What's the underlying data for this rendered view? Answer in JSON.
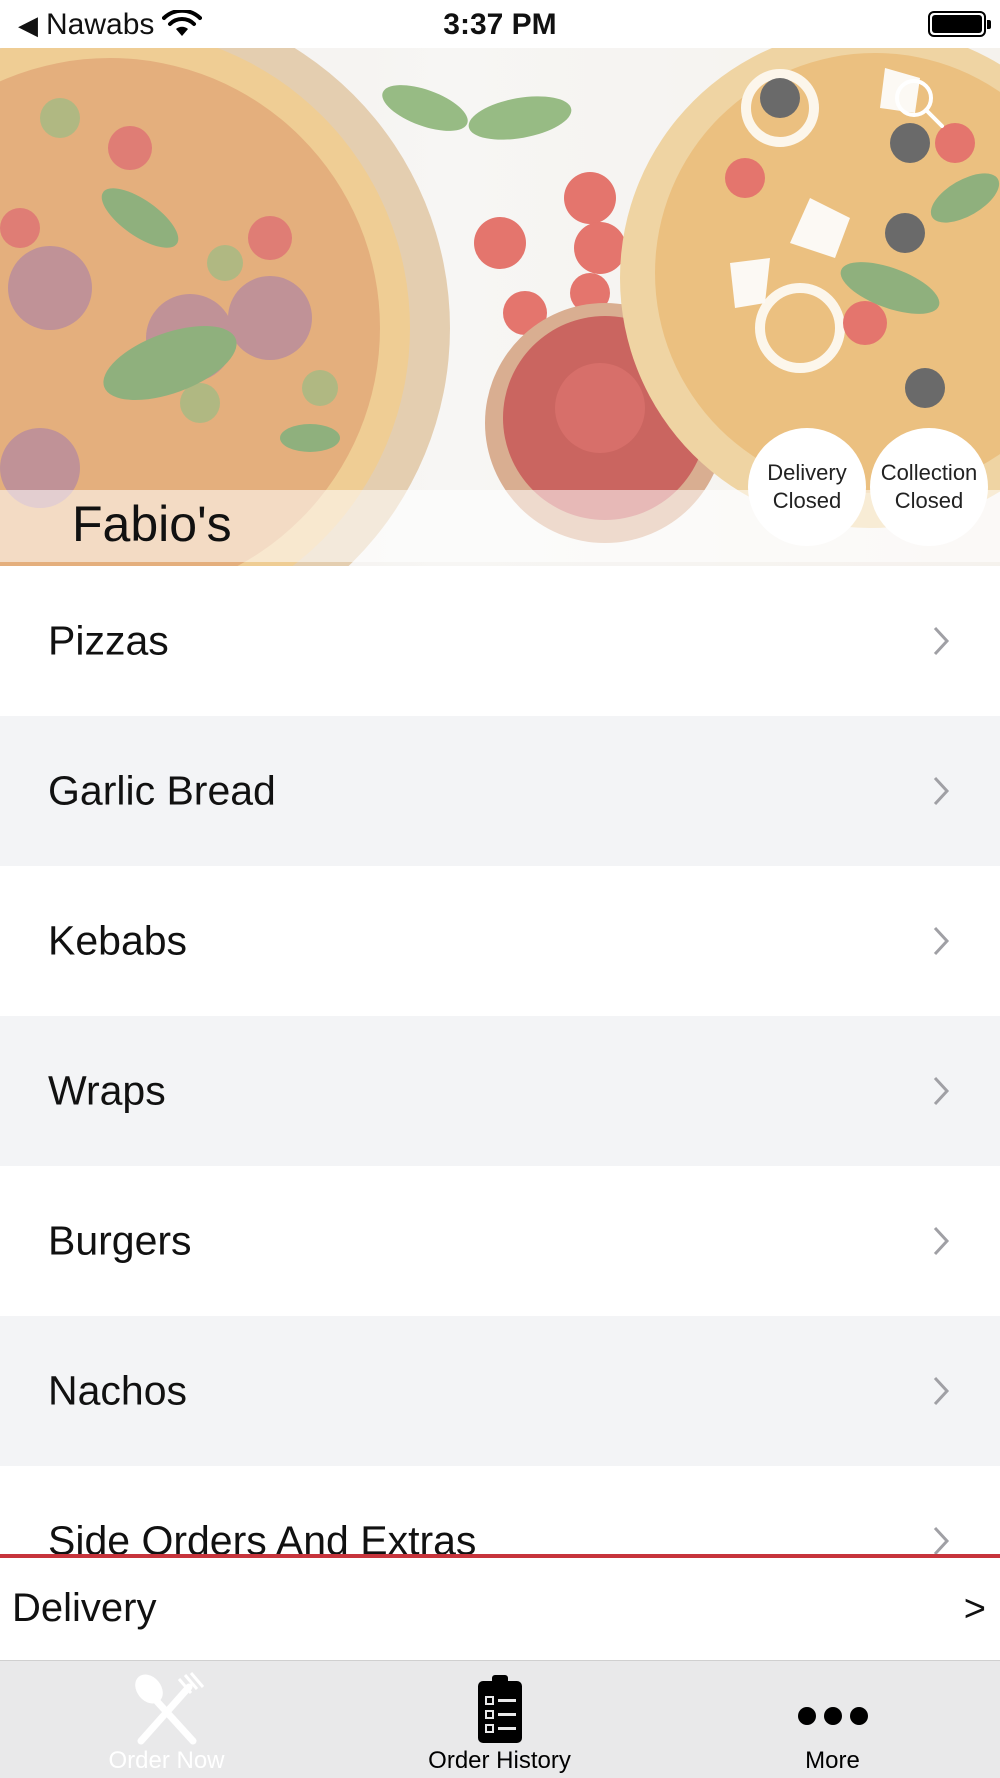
{
  "status_bar": {
    "back_glyph": "◀",
    "carrier": "Nawabs",
    "time": "3:37 PM",
    "icons": [
      "wifi-icon",
      "battery-icon"
    ]
  },
  "hero": {
    "restaurant_name": "Fabio's",
    "search_icon": "search-icon",
    "badges": {
      "delivery": {
        "line1": "Delivery",
        "line2": "Closed"
      },
      "collection": {
        "line1": "Collection",
        "line2": "Closed"
      }
    }
  },
  "categories": [
    {
      "label": "Pizzas"
    },
    {
      "label": "Garlic Bread"
    },
    {
      "label": "Kebabs"
    },
    {
      "label": "Wraps"
    },
    {
      "label": "Burgers"
    },
    {
      "label": "Nachos"
    },
    {
      "label": "Side Orders And Extras"
    }
  ],
  "delivery_bar": {
    "label": "Delivery",
    "arrow": ">",
    "accent_color": "#c7343c"
  },
  "tab_bar": {
    "tabs": [
      {
        "label": "Order Now",
        "icon": "fork-knife-icon",
        "active": true
      },
      {
        "label": "Order History",
        "icon": "clipboard-icon",
        "active": false
      },
      {
        "label": "More",
        "icon": "more-dots-icon",
        "active": false
      }
    ]
  }
}
